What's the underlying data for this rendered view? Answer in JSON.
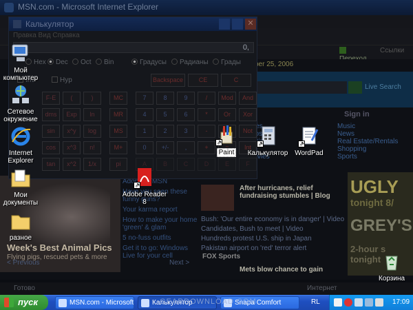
{
  "ie": {
    "title": "MSN.com - Microsoft Internet Explorer",
    "go_label": "Переход",
    "links_label": "Ссылки",
    "status_text": "Готово",
    "zone_text": "Интернет"
  },
  "msn": {
    "date": "ber 25, 2006",
    "live_search": "Live Search",
    "sign_in": "Sign in",
    "categories": [
      "Music",
      "News",
      "Real Estate/Rentals",
      "Shopping",
      "Sports"
    ],
    "categories_mid": [
      "opes",
      "Jobs",
      "e Direct",
      "ns",
      "Movies"
    ],
    "links": [
      "Adopt an MSN",
      "...ns",
      "Have you seen these funny guns?",
      "Your karma report",
      "How to make your home 'green' & glam",
      "5 no-fuss outfits",
      "Get it to go: Windows Live for your cell"
    ],
    "feature_caption": "Week's Best Animal Pics",
    "feature_sub": "Flying pigs, rescued pets & more",
    "prev": "< Previous",
    "next": "Next >",
    "news_headline": "After hurricanes, relief fundraising stumbles | Blog",
    "news_items": [
      "Bush: 'Our entire economy is in danger' | Video",
      "Candidates, Bush to meet | Video",
      "Hundreds protest U.S. ship in Japan",
      "Pakistan airport on 'red' terror alert"
    ],
    "fox_label": "FOX Sports",
    "fox_headline": "Mets blow chance to gain",
    "ad_line1": "UGLY",
    "ad_line2": "tonight 8/",
    "ad_line3": "GREY'S",
    "ad_line4": "2-hour s tonight"
  },
  "calculator": {
    "title": "Калькулятор",
    "menu": "Правка  Вид  Справка",
    "display": "0,",
    "radios_base": [
      {
        "label": "Hex",
        "on": false
      },
      {
        "label": "Dec",
        "on": true
      },
      {
        "label": "Oct",
        "on": false
      },
      {
        "label": "Bin",
        "on": false
      }
    ],
    "radios_angle": [
      {
        "label": "Градусы",
        "on": true
      },
      {
        "label": "Радианы",
        "on": false
      },
      {
        "label": "Грады",
        "on": false
      }
    ],
    "inv_label": "Inv",
    "hyp_label": "Hyp",
    "top_buttons": [
      "Backspace",
      "CE",
      "C"
    ],
    "sci_rows": [
      [
        "F-E",
        "(",
        ")"
      ],
      [
        "dms",
        "Exp",
        "ln"
      ],
      [
        "sin",
        "x^y",
        "log"
      ],
      [
        "cos",
        "x^3",
        "n!"
      ],
      [
        "tan",
        "x^2",
        "1/x"
      ]
    ],
    "mem_col": [
      "MC",
      "MR",
      "MS",
      "M+",
      "pi"
    ],
    "num_rows": [
      [
        "7",
        "8",
        "9",
        "/",
        "Mod",
        "And"
      ],
      [
        "4",
        "5",
        "6",
        "*",
        "Or",
        "Xor"
      ],
      [
        "1",
        "2",
        "3",
        "-",
        "Lsh",
        "Not"
      ],
      [
        "0",
        "+/-",
        ",",
        "+",
        "=",
        "Int"
      ]
    ],
    "hex_rows": [
      "A",
      "B",
      "C",
      "D",
      "E",
      "F"
    ]
  },
  "desktop": [
    {
      "name": "Мой компьютер",
      "icon": "my-computer-icon"
    },
    {
      "name": "Сетевое окружение",
      "icon": "network-places-icon"
    },
    {
      "name": "Internet Explorer",
      "icon": "internet-explorer-icon"
    },
    {
      "name": "Мои документы",
      "icon": "my-documents-icon"
    },
    {
      "name": "разное",
      "icon": "folder-icon"
    },
    {
      "name": "Adobe Reader 8",
      "icon": "adobe-reader-icon"
    },
    {
      "name": "Paint",
      "icon": "paint-icon"
    },
    {
      "name": "Калькулятор",
      "icon": "calculator-icon"
    },
    {
      "name": "WordPad",
      "icon": "wordpad-icon"
    },
    {
      "name": "Корзина",
      "icon": "recycle-bin-icon"
    }
  ],
  "taskbar": {
    "start_label": "пуск",
    "tasks": [
      "MSN.com - Microsoft ...",
      "Калькулятор",
      "Snapa Comfort"
    ],
    "lang": "RL",
    "clock": "17:09",
    "watermark": "GEARDOWNLOAD.COM"
  }
}
